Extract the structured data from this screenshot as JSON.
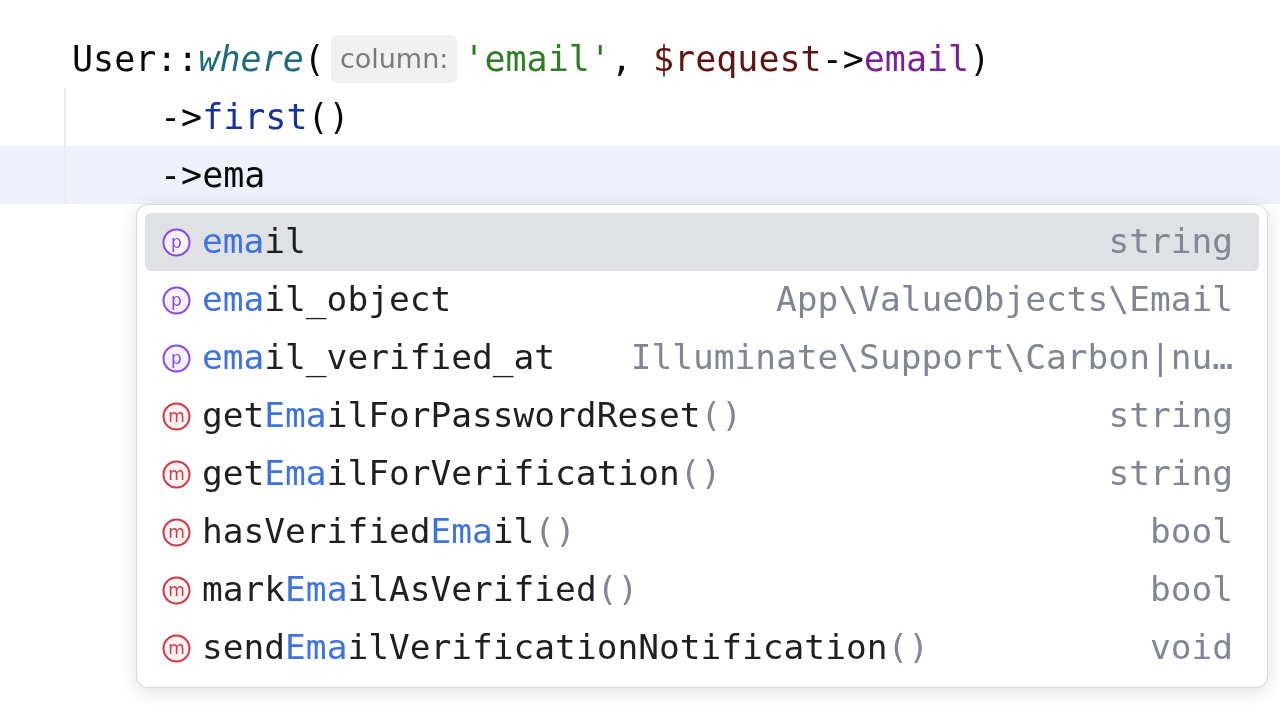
{
  "code_lines": [
    {
      "current": false,
      "parts": [
        {
          "kind": "code",
          "tokens": [
            {
              "kind": "class",
              "text": "User::"
            },
            {
              "kind": "static",
              "text": "where"
            },
            {
              "kind": "plain",
              "text": "("
            }
          ]
        },
        {
          "kind": "hint",
          "text": "column:"
        },
        {
          "kind": "code",
          "tokens": [
            {
              "kind": "string",
              "text": "'email'"
            },
            {
              "kind": "plain",
              "text": ", "
            },
            {
              "kind": "variable",
              "text": "$request"
            },
            {
              "kind": "plain",
              "text": "->"
            },
            {
              "kind": "property",
              "text": "email"
            },
            {
              "kind": "plain",
              "text": ")"
            }
          ]
        }
      ],
      "children": [
        {
          "current": false,
          "parts": [
            {
              "kind": "code",
              "tokens": [
                {
                  "kind": "plain",
                  "text": "->"
                },
                {
                  "kind": "method",
                  "text": "first"
                },
                {
                  "kind": "plain",
                  "text": "()"
                }
              ]
            }
          ]
        },
        {
          "current": true,
          "parts": [
            {
              "kind": "code",
              "tokens": [
                {
                  "kind": "plain",
                  "text": "->ema"
                }
              ]
            }
          ]
        }
      ]
    }
  ],
  "completion": {
    "items": [
      {
        "kind": "property",
        "badge": "p",
        "match": "ema",
        "after": "il",
        "type": "string",
        "selected": true
      },
      {
        "kind": "property",
        "badge": "p",
        "match": "ema",
        "after": "il_object",
        "type": "App\\ValueObjects\\Email",
        "selected": false
      },
      {
        "kind": "property",
        "badge": "p",
        "match": "ema",
        "after": "il_verified_at",
        "type": "Illuminate\\Support\\Carbon|nu…",
        "selected": false
      },
      {
        "kind": "method",
        "badge": "m",
        "before": "get",
        "match": "Ema",
        "after": "ilForPasswordReset",
        "params": "()",
        "type": "string",
        "selected": false
      },
      {
        "kind": "method",
        "badge": "m",
        "before": "get",
        "match": "Ema",
        "after": "ilForVerification",
        "params": "()",
        "type": "string",
        "selected": false
      },
      {
        "kind": "method",
        "badge": "m",
        "before": "hasVerified",
        "match": "Ema",
        "after": "il",
        "params": "()",
        "type": "bool",
        "selected": false
      },
      {
        "kind": "method",
        "badge": "m",
        "before": "mark",
        "match": "Ema",
        "after": "ilAsVerified",
        "params": "()",
        "type": "bool",
        "selected": false
      },
      {
        "kind": "method",
        "badge": "m",
        "before": "send",
        "match": "Ema",
        "after": "ilVerificationNotification",
        "params": "()",
        "type": "void",
        "selected": false
      }
    ]
  }
}
